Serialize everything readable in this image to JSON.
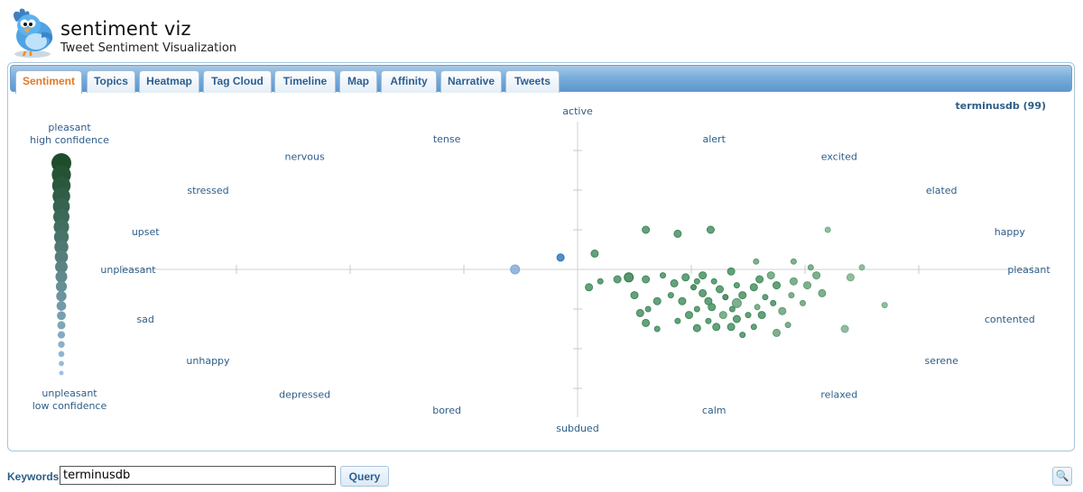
{
  "header": {
    "title": "sentiment viz",
    "subtitle": "Tweet Sentiment Visualization",
    "logo_icon": "twitter-bird-icon"
  },
  "tabs": [
    {
      "label": "Sentiment",
      "active": true
    },
    {
      "label": "Topics",
      "active": false
    },
    {
      "label": "Heatmap",
      "active": false
    },
    {
      "label": "Tag Cloud",
      "active": false
    },
    {
      "label": "Timeline",
      "active": false
    },
    {
      "label": "Map",
      "active": false
    },
    {
      "label": "Affinity",
      "active": false
    },
    {
      "label": "Narrative",
      "active": false
    },
    {
      "label": "Tweets",
      "active": false
    }
  ],
  "legend": {
    "top": [
      "pleasant",
      "high confidence"
    ],
    "bottom": [
      "unpleasant",
      "low confidence"
    ],
    "colors": {
      "pleasant": "#1e4d2b",
      "unpleasant": "#9cc0e6"
    }
  },
  "query": {
    "label": "Keywords:",
    "value": "terminusdb",
    "button_label": "Query",
    "zoom_icon": "magnifier-icon"
  },
  "chart_data": {
    "type": "scatter",
    "title": "",
    "series_label": "terminusdb (99)",
    "x_axis": {
      "left_label": "unpleasant",
      "right_label": "pleasant",
      "range": [
        1,
        9
      ],
      "center": 5
    },
    "y_axis": {
      "top_label": "active",
      "bottom_label": "subdued",
      "range": [
        1,
        9
      ],
      "center": 5
    },
    "mood_labels": [
      {
        "text": "tense",
        "x": 3.85,
        "y": 8.3
      },
      {
        "text": "nervous",
        "x": 2.6,
        "y": 7.85
      },
      {
        "text": "stressed",
        "x": 1.75,
        "y": 7.0
      },
      {
        "text": "upset",
        "x": 1.2,
        "y": 5.95
      },
      {
        "text": "alert",
        "x": 6.2,
        "y": 8.3
      },
      {
        "text": "excited",
        "x": 7.3,
        "y": 7.85
      },
      {
        "text": "elated",
        "x": 8.2,
        "y": 7.0
      },
      {
        "text": "happy",
        "x": 8.8,
        "y": 5.95
      },
      {
        "text": "sad",
        "x": 1.2,
        "y": 3.75
      },
      {
        "text": "unhappy",
        "x": 1.75,
        "y": 2.7
      },
      {
        "text": "depressed",
        "x": 2.6,
        "y": 1.85
      },
      {
        "text": "bored",
        "x": 3.85,
        "y": 1.45
      },
      {
        "text": "contented",
        "x": 8.8,
        "y": 3.75
      },
      {
        "text": "serene",
        "x": 8.2,
        "y": 2.7
      },
      {
        "text": "relaxed",
        "x": 7.3,
        "y": 1.85
      },
      {
        "text": "calm",
        "x": 6.2,
        "y": 1.45
      }
    ],
    "points": [
      {
        "x": 4.45,
        "y": 5.0,
        "r": 5,
        "color": "#7fa8d6"
      },
      {
        "x": 4.85,
        "y": 5.3,
        "r": 4,
        "color": "#2a73b8"
      },
      {
        "x": 5.15,
        "y": 5.4,
        "r": 4,
        "color": "#3f8a5a"
      },
      {
        "x": 5.6,
        "y": 6.0,
        "r": 4,
        "color": "#3f8a5a"
      },
      {
        "x": 5.88,
        "y": 5.9,
        "r": 4,
        "color": "#3f8a5a"
      },
      {
        "x": 6.17,
        "y": 6.0,
        "r": 4,
        "color": "#3f8a5a"
      },
      {
        "x": 7.2,
        "y": 6.0,
        "r": 3,
        "color": "#76ad88"
      },
      {
        "x": 6.57,
        "y": 5.2,
        "r": 3,
        "color": "#5f9c72"
      },
      {
        "x": 6.9,
        "y": 5.2,
        "r": 3,
        "color": "#5f9c72"
      },
      {
        "x": 7.1,
        "y": 4.85,
        "r": 4,
        "color": "#5f9c72"
      },
      {
        "x": 7.05,
        "y": 5.05,
        "r": 3,
        "color": "#5f9c72"
      },
      {
        "x": 5.1,
        "y": 4.55,
        "r": 4,
        "color": "#3f8a5a"
      },
      {
        "x": 5.2,
        "y": 4.7,
        "r": 3,
        "color": "#3f8a5a"
      },
      {
        "x": 5.35,
        "y": 4.75,
        "r": 4,
        "color": "#3f8a5a"
      },
      {
        "x": 5.45,
        "y": 4.8,
        "r": 5,
        "color": "#2f7a4a"
      },
      {
        "x": 5.6,
        "y": 4.75,
        "r": 4,
        "color": "#3f8a5a"
      },
      {
        "x": 5.5,
        "y": 4.35,
        "r": 4,
        "color": "#3f8a5a"
      },
      {
        "x": 5.7,
        "y": 4.2,
        "r": 4,
        "color": "#3f8a5a"
      },
      {
        "x": 5.62,
        "y": 4.0,
        "r": 3,
        "color": "#3f8a5a"
      },
      {
        "x": 5.55,
        "y": 3.9,
        "r": 4,
        "color": "#3f8a5a"
      },
      {
        "x": 5.6,
        "y": 3.65,
        "r": 4,
        "color": "#3f8a5a"
      },
      {
        "x": 5.75,
        "y": 4.85,
        "r": 3,
        "color": "#3f8a5a"
      },
      {
        "x": 5.85,
        "y": 4.65,
        "r": 4,
        "color": "#3f8a5a"
      },
      {
        "x": 5.95,
        "y": 4.8,
        "r": 4,
        "color": "#3f8a5a"
      },
      {
        "x": 5.82,
        "y": 4.35,
        "r": 3,
        "color": "#3f8a5a"
      },
      {
        "x": 5.92,
        "y": 4.2,
        "r": 4,
        "color": "#3f8a5a"
      },
      {
        "x": 6.02,
        "y": 4.55,
        "r": 3,
        "color": "#2f7a4a"
      },
      {
        "x": 6.1,
        "y": 4.85,
        "r": 4,
        "color": "#3f8a5a"
      },
      {
        "x": 6.05,
        "y": 4.7,
        "r": 3,
        "color": "#3f8a5a"
      },
      {
        "x": 6.1,
        "y": 4.4,
        "r": 4,
        "color": "#3f8a5a"
      },
      {
        "x": 6.15,
        "y": 4.2,
        "r": 4,
        "color": "#3f8a5a"
      },
      {
        "x": 6.05,
        "y": 4.0,
        "r": 3,
        "color": "#3f8a5a"
      },
      {
        "x": 5.98,
        "y": 3.85,
        "r": 4,
        "color": "#3f8a5a"
      },
      {
        "x": 6.2,
        "y": 4.7,
        "r": 3,
        "color": "#3f8a5a"
      },
      {
        "x": 6.25,
        "y": 4.5,
        "r": 4,
        "color": "#3f8a5a"
      },
      {
        "x": 6.3,
        "y": 4.3,
        "r": 3,
        "color": "#2f7a4a"
      },
      {
        "x": 6.18,
        "y": 4.05,
        "r": 4,
        "color": "#3f8a5a"
      },
      {
        "x": 6.28,
        "y": 3.85,
        "r": 4,
        "color": "#5f9c72"
      },
      {
        "x": 6.15,
        "y": 3.7,
        "r": 3,
        "color": "#3f8a5a"
      },
      {
        "x": 6.22,
        "y": 3.55,
        "r": 4,
        "color": "#3f8a5a"
      },
      {
        "x": 6.35,
        "y": 4.95,
        "r": 4,
        "color": "#3f8a5a"
      },
      {
        "x": 6.4,
        "y": 4.6,
        "r": 3,
        "color": "#3f8a5a"
      },
      {
        "x": 6.45,
        "y": 4.35,
        "r": 4,
        "color": "#3f8a5a"
      },
      {
        "x": 6.4,
        "y": 4.15,
        "r": 5,
        "color": "#5f9c72"
      },
      {
        "x": 6.36,
        "y": 4.0,
        "r": 3,
        "color": "#3f8a5a"
      },
      {
        "x": 6.4,
        "y": 3.75,
        "r": 4,
        "color": "#3f8a5a"
      },
      {
        "x": 6.5,
        "y": 3.85,
        "r": 3,
        "color": "#3f8a5a"
      },
      {
        "x": 6.55,
        "y": 4.55,
        "r": 4,
        "color": "#3f8a5a"
      },
      {
        "x": 6.6,
        "y": 4.75,
        "r": 4,
        "color": "#3f8a5a"
      },
      {
        "x": 6.65,
        "y": 4.3,
        "r": 3,
        "color": "#3f8a5a"
      },
      {
        "x": 6.7,
        "y": 4.85,
        "r": 4,
        "color": "#5f9c72"
      },
      {
        "x": 6.75,
        "y": 4.6,
        "r": 4,
        "color": "#3f8a5a"
      },
      {
        "x": 6.58,
        "y": 4.05,
        "r": 3,
        "color": "#5f9c72"
      },
      {
        "x": 6.62,
        "y": 3.85,
        "r": 4,
        "color": "#3f8a5a"
      },
      {
        "x": 6.72,
        "y": 4.15,
        "r": 3,
        "color": "#3f8a5a"
      },
      {
        "x": 6.8,
        "y": 3.95,
        "r": 4,
        "color": "#5f9c72"
      },
      {
        "x": 6.9,
        "y": 4.7,
        "r": 4,
        "color": "#5f9c72"
      },
      {
        "x": 6.88,
        "y": 4.35,
        "r": 3,
        "color": "#5f9c72"
      },
      {
        "x": 7.02,
        "y": 4.6,
        "r": 4,
        "color": "#5f9c72"
      },
      {
        "x": 6.98,
        "y": 4.15,
        "r": 3,
        "color": "#5f9c72"
      },
      {
        "x": 7.15,
        "y": 4.4,
        "r": 4,
        "color": "#5f9c72"
      },
      {
        "x": 7.4,
        "y": 4.8,
        "r": 4,
        "color": "#76ad88"
      },
      {
        "x": 7.5,
        "y": 5.05,
        "r": 3,
        "color": "#76ad88"
      },
      {
        "x": 7.7,
        "y": 4.1,
        "r": 3,
        "color": "#76ad88"
      },
      {
        "x": 7.35,
        "y": 3.5,
        "r": 4,
        "color": "#76ad88"
      },
      {
        "x": 6.85,
        "y": 3.6,
        "r": 3,
        "color": "#5f9c72"
      },
      {
        "x": 6.75,
        "y": 3.4,
        "r": 4,
        "color": "#5f9c72"
      },
      {
        "x": 6.45,
        "y": 3.35,
        "r": 3,
        "color": "#3f8a5a"
      },
      {
        "x": 6.55,
        "y": 3.55,
        "r": 3,
        "color": "#3f8a5a"
      },
      {
        "x": 5.7,
        "y": 3.5,
        "r": 3,
        "color": "#3f8a5a"
      },
      {
        "x": 5.88,
        "y": 3.7,
        "r": 3,
        "color": "#3f8a5a"
      },
      {
        "x": 6.05,
        "y": 3.52,
        "r": 4,
        "color": "#3f8a5a"
      },
      {
        "x": 6.35,
        "y": 3.55,
        "r": 4,
        "color": "#3f8a5a"
      }
    ]
  }
}
